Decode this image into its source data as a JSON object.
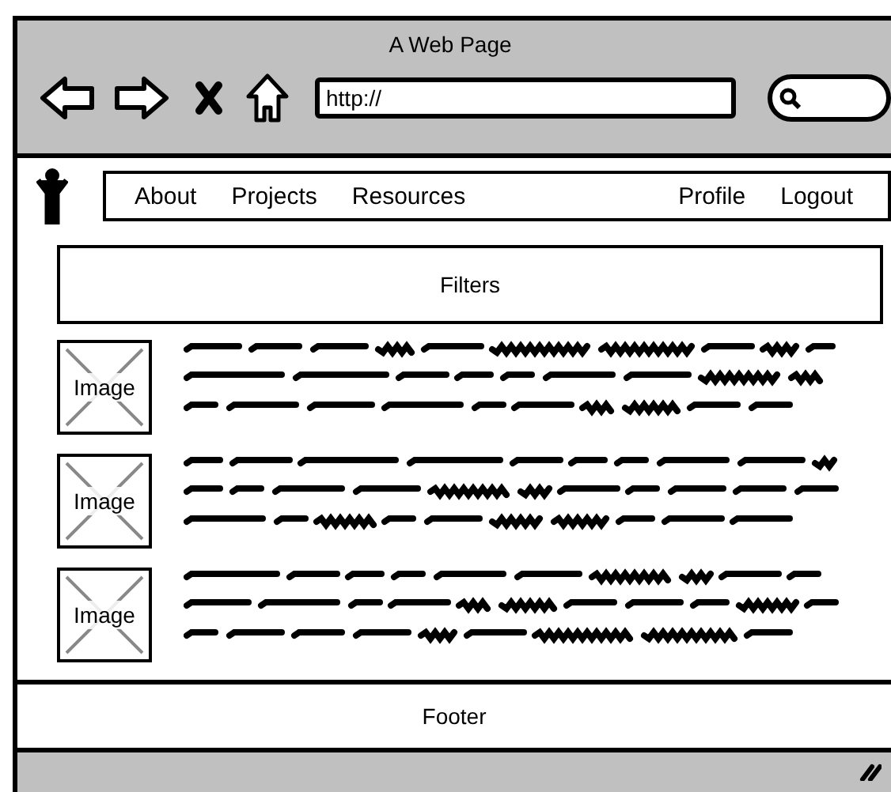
{
  "window": {
    "title": "A Web Page"
  },
  "address_bar": {
    "value": "http://"
  },
  "nav": {
    "left": [
      {
        "label": "About"
      },
      {
        "label": "Projects"
      },
      {
        "label": "Resources"
      }
    ],
    "right": [
      {
        "label": "Profile"
      },
      {
        "label": "Logout"
      }
    ]
  },
  "filters": {
    "label": "Filters"
  },
  "items": [
    {
      "image_label": "Image"
    },
    {
      "image_label": "Image"
    },
    {
      "image_label": "Image"
    }
  ],
  "footer": {
    "label": "Footer"
  }
}
